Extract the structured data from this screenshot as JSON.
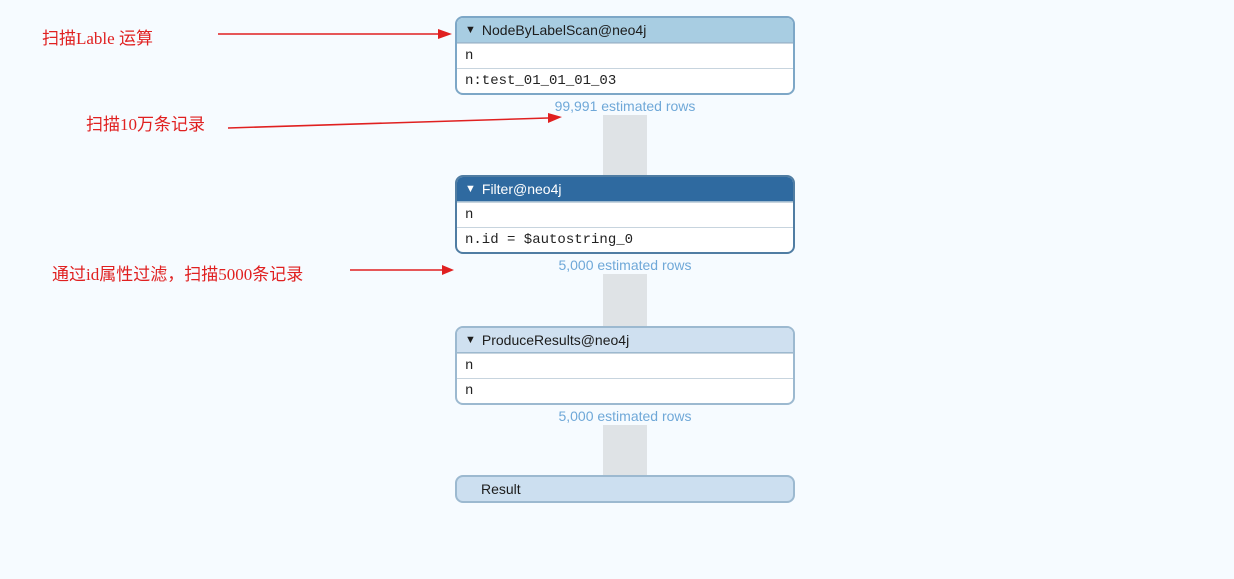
{
  "annotations": {
    "scan_label": "扫描Lable 运算",
    "scan_rows": "扫描10万条记录",
    "filter_id": "通过id属性过滤，扫描5000条记录"
  },
  "plan": {
    "node_scan": {
      "title": "NodeByLabelScan@neo4j",
      "var": "n",
      "detail": "n:test_01_01_01_03",
      "est": "99,991 estimated rows"
    },
    "filter": {
      "title": "Filter@neo4j",
      "var": "n",
      "detail": "n.id = $autostring_0",
      "est": "5,000 estimated rows"
    },
    "produce": {
      "title": "ProduceResults@neo4j",
      "var1": "n",
      "var2": "n",
      "est": "5,000 estimated rows"
    },
    "result": "Result"
  }
}
